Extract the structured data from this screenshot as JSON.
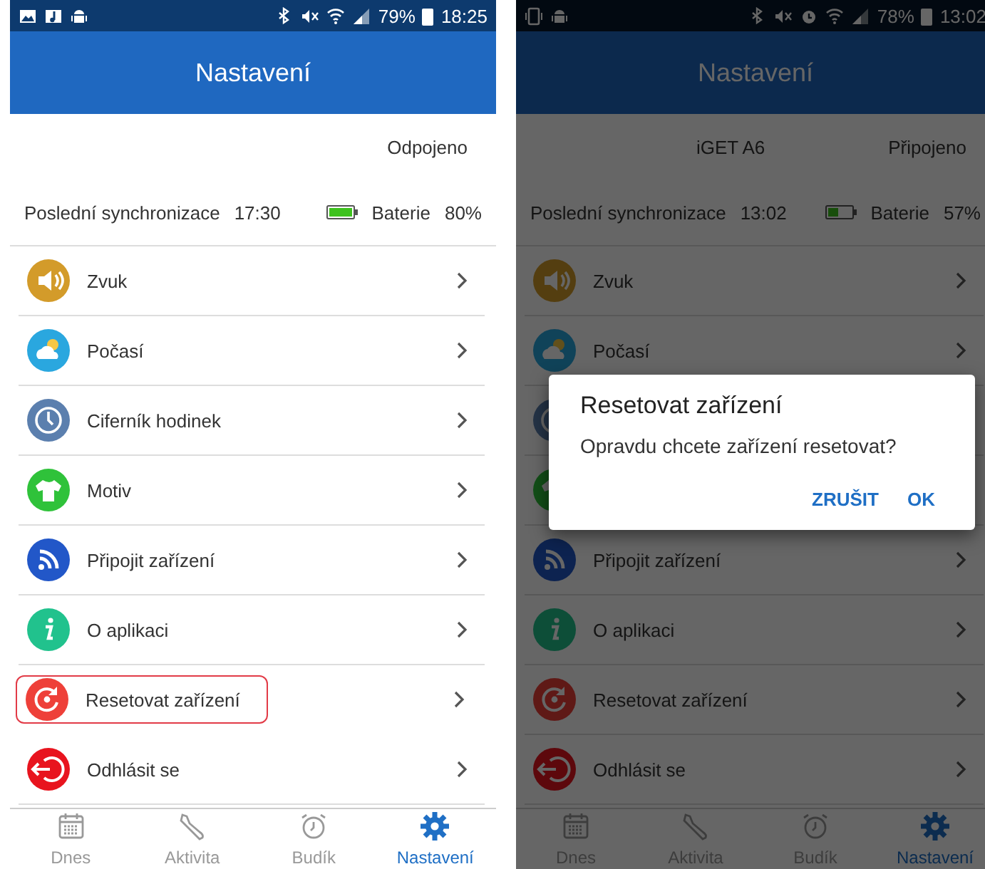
{
  "screens": [
    {
      "status_bar": {
        "battery": "79%",
        "time": "18:25"
      },
      "header": {
        "title": "Nastavení"
      },
      "device": {
        "status": "Odpojeno"
      },
      "sync": {
        "label": "Poslední synchronizace",
        "time": "17:30",
        "battery_label": "Baterie",
        "battery": "80%"
      },
      "items": [
        {
          "label": "Zvuk",
          "highlighted": false
        },
        {
          "label": "Počasí",
          "highlighted": false
        },
        {
          "label": "Ciferník hodinek",
          "highlighted": false
        },
        {
          "label": "Motiv",
          "highlighted": false
        },
        {
          "label": "Připojit zařízení",
          "highlighted": false
        },
        {
          "label": "O aplikaci",
          "highlighted": false
        },
        {
          "label": "Resetovat zařízení",
          "highlighted": true
        },
        {
          "label": "Odhlásit se",
          "highlighted": false
        }
      ],
      "tabs": [
        {
          "label": "Dnes",
          "selected": false
        },
        {
          "label": "Aktivita",
          "selected": false
        },
        {
          "label": "Budík",
          "selected": false
        },
        {
          "label": "Nastavení",
          "selected": true
        }
      ],
      "dimmed": false
    },
    {
      "status_bar": {
        "battery": "78%",
        "time": "13:02"
      },
      "header": {
        "title": "Nastavení"
      },
      "device": {
        "name": "iGET A6",
        "status": "Připojeno"
      },
      "sync": {
        "label": "Poslední synchronizace",
        "time": "13:02",
        "battery_label": "Baterie",
        "battery": "57%"
      },
      "items": [
        {
          "label": "Zvuk",
          "highlighted": false
        },
        {
          "label": "Počasí",
          "highlighted": false
        },
        {
          "highlighted": false
        },
        {
          "highlighted": false
        },
        {
          "label": "Připojit zařízení",
          "highlighted": false
        },
        {
          "label": "O aplikaci",
          "highlighted": false
        },
        {
          "label": "Resetovat zařízení",
          "highlighted": false
        },
        {
          "label": "Odhlásit se",
          "highlighted": false
        }
      ],
      "tabs": [
        {
          "label": "Dnes",
          "selected": false
        },
        {
          "label": "Aktivita",
          "selected": false
        },
        {
          "label": "Budík",
          "selected": false
        },
        {
          "label": "Nastavení",
          "selected": true
        }
      ],
      "dimmed": true,
      "dialog": {
        "title": "Resetovat zařízení",
        "message": "Opravdu chcete zařízení resetovat?",
        "buttons": [
          "ZRUŠIT",
          "OK"
        ]
      }
    }
  ]
}
